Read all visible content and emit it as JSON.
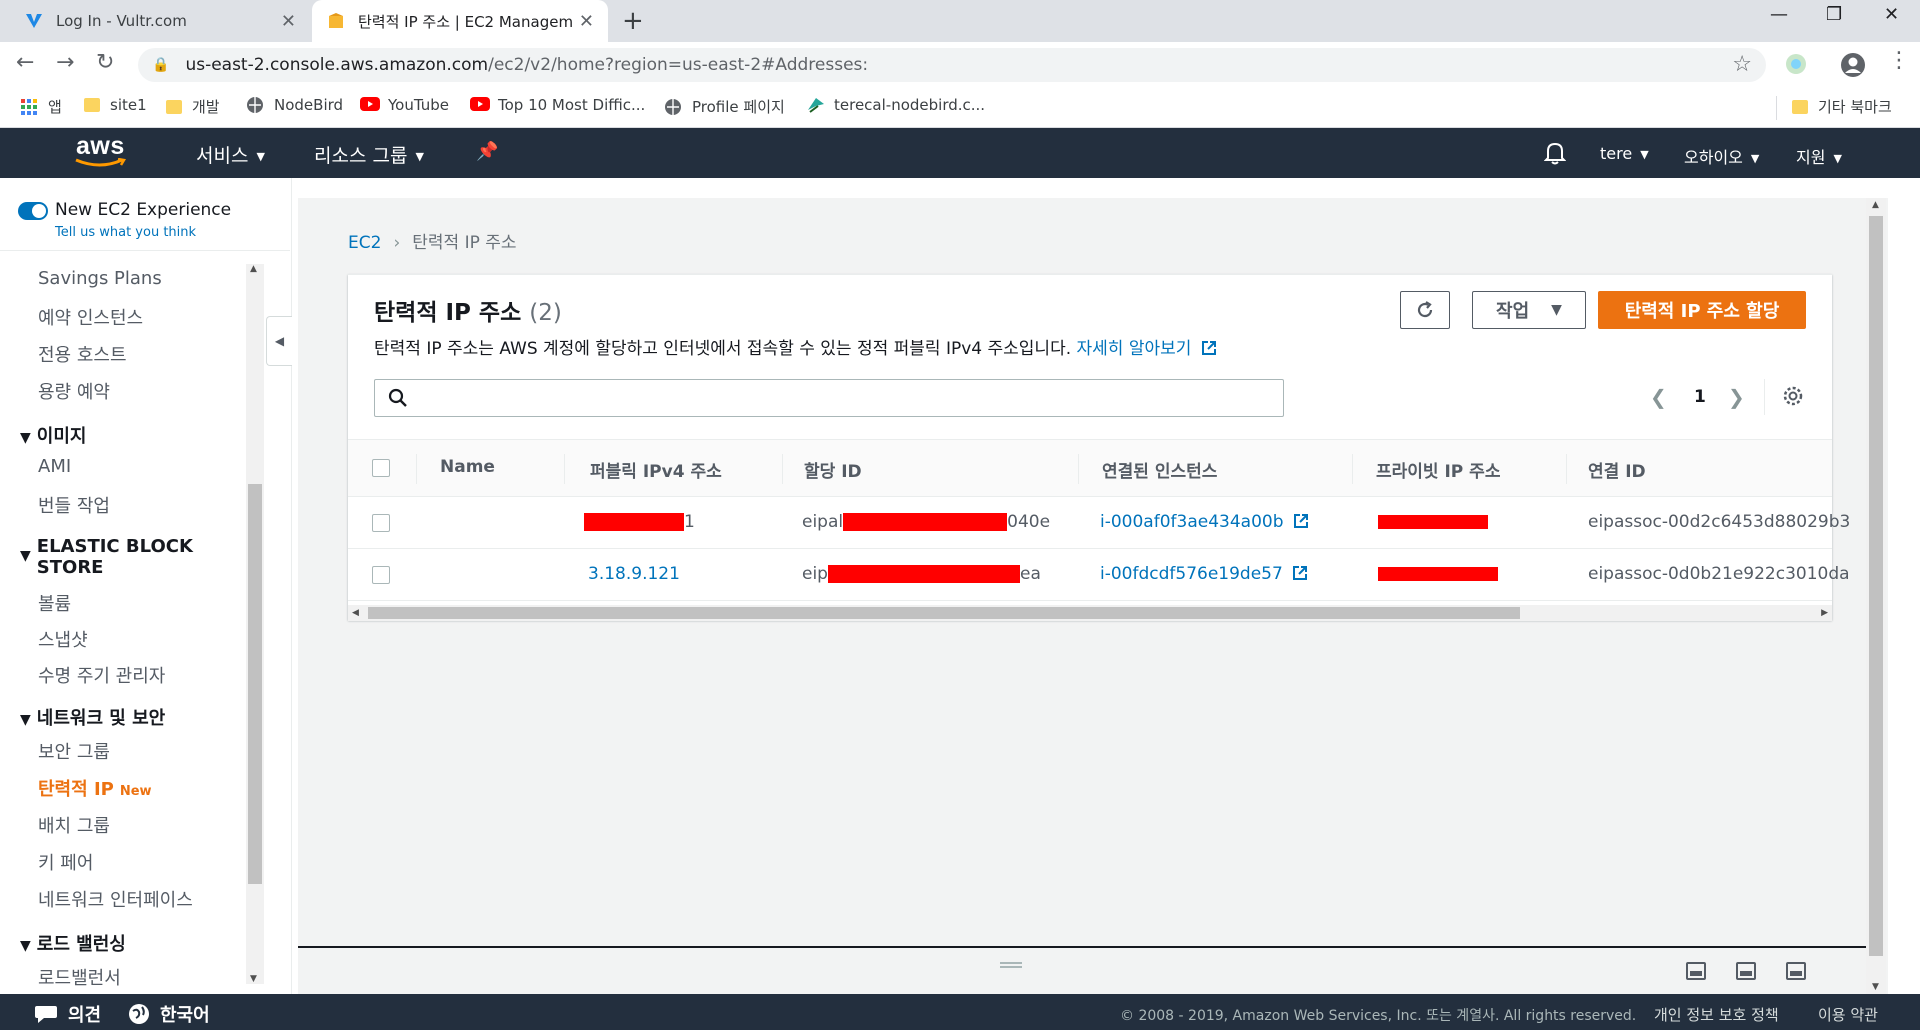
{
  "browser": {
    "tabs": [
      {
        "title": "Log In - Vultr.com",
        "favicon": "vultr-v-icon"
      },
      {
        "title": "탄력적 IP 주소 | EC2 Manageme",
        "favicon": "aws-box-icon"
      }
    ],
    "url_host": "us-east-2.console.aws.amazon.com",
    "url_path": "/ec2/v2/home?region=us-east-2#Addresses:",
    "bookmarks": [
      "앱",
      "site1",
      "개발",
      "NodeBird",
      "YouTube",
      "Top 10 Most Diffic...",
      "Profile 페이지",
      "terecal-nodebird.c...",
      "기타 북마크"
    ]
  },
  "aws_nav": {
    "logo": "aws",
    "services": "서비스",
    "resource_groups": "리소스 그룹",
    "user": "tere",
    "region": "오하이오",
    "support": "지원"
  },
  "sidebar": {
    "experience_label": "New EC2 Experience",
    "experience_link": "Tell us what you think",
    "items": {
      "savings_plans": "Savings Plans",
      "reserved_instances": "예약 인스턴스",
      "dedicated_hosts": "전용 호스트",
      "capacity_reservations": "용량 예약",
      "images_head": "이미지",
      "ami": "AMI",
      "bundle_tasks": "번들 작업",
      "ebs_head_1": "ELASTIC BLOCK",
      "ebs_head_2": "STORE",
      "volumes": "볼륨",
      "snapshots": "스냅샷",
      "lifecycle_manager": "수명 주기 관리자",
      "network_head": "네트워크 및 보안",
      "security_groups": "보안 그룹",
      "elastic_ips": "탄력적 IP",
      "elastic_ips_badge": "New",
      "placement_groups": "배치 그룹",
      "key_pairs": "키 페어",
      "network_interfaces": "네트워크 인터페이스",
      "lb_head": "로드 밸런싱",
      "load_balancers": "로드밸런서"
    }
  },
  "breadcrumb": {
    "root": "EC2",
    "current": "탄력적 IP 주소"
  },
  "panel": {
    "title": "탄력적 IP 주소",
    "count": "(2)",
    "description": "탄력적 IP 주소는 AWS 계정에 할당하고 인터넷에서 접속할 수 있는 정적 퍼블릭 IPv4 주소입니다.",
    "learn_more": "자세히 알아보기",
    "actions_label": "작업",
    "allocate_label": "탄력적 IP 주소 할당",
    "page_number": "1",
    "search_placeholder": ""
  },
  "table": {
    "columns": [
      "Name",
      "퍼블릭 IPv4 주소",
      "할당 ID",
      "연결된 인스턴스",
      "프라이빗 IP 주소",
      "연결 ID"
    ],
    "rows": [
      {
        "name": "",
        "public_ip_suffix": "1",
        "alloc_prefix": "eipal",
        "alloc_suffix": "040e",
        "instance": "i-000af0f3ae434a00b",
        "association": "eipassoc-00d2c6453d88029b3"
      },
      {
        "name": "",
        "public_ip": "3.18.9.121",
        "alloc_prefix": "eip",
        "alloc_suffix": "ea",
        "instance": "i-00fdcdf576e19de57",
        "association": "eipassoc-0d0b21e922c3010da"
      }
    ]
  },
  "footer": {
    "feedback": "의견",
    "language": "한국어",
    "copyright": "© 2008 - 2019, Amazon Web Services, Inc. 또는 계열사. All rights reserved.",
    "privacy": "개인 정보 보호 정책",
    "terms": "이용 약관"
  },
  "colors": {
    "accent": "#ec7211",
    "link": "#0073bb",
    "nav_bg": "#232f3e",
    "redaction": "#ff0000"
  }
}
